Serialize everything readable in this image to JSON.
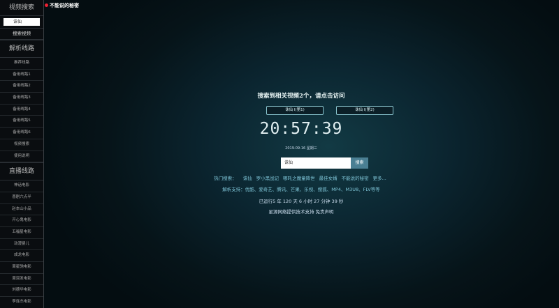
{
  "logo": {
    "text": "不能说的秘密"
  },
  "sidebar": {
    "search_title": "视频搜索",
    "search_value": "诛仙",
    "search_button": "搜索视频",
    "parse_title": "解析线路",
    "parse_items": [
      "推荐线路",
      "备用线路1",
      "备用线路2",
      "备用线路3",
      "备用线路4",
      "备用线路5",
      "备用线路6",
      "视频搜索",
      "使用说明"
    ],
    "live_title": "直播线路",
    "live_items": [
      "神话电影",
      "喜剧六点半",
      "赵本山小品",
      "开心鬼电影",
      "五福星电影",
      "动漫婴儿",
      "成龙电影",
      "周星驰电影",
      "周润发电影",
      "刘德华电影",
      "李连杰电影"
    ]
  },
  "main": {
    "title": "搜索到相关视频2个，请点击访问",
    "results": [
      "诛仙 Ⅰ(第1)",
      "诛仙 Ⅰ(第2)"
    ],
    "clock": "20:57:39",
    "date": "2019-09-16 星期三",
    "search_value": "诛仙",
    "search_button": "搜索",
    "hot_label": "热门搜索：",
    "hot_items": [
      "诛仙",
      "罗小黑战记",
      "哪吒之魔童降世",
      "最佳女婿",
      "不能说的秘密",
      "更多..."
    ],
    "support_text": "解析支持：优酷、爱奇艺、腾讯、芒果、乐视、搜狐、MP4、M3U8、FLV等等",
    "runtime_text": "已运行5 年 120 天 6 小时 27 分钟 39 秒",
    "footer_text": "星源网络提供技术支持 免责声明"
  }
}
